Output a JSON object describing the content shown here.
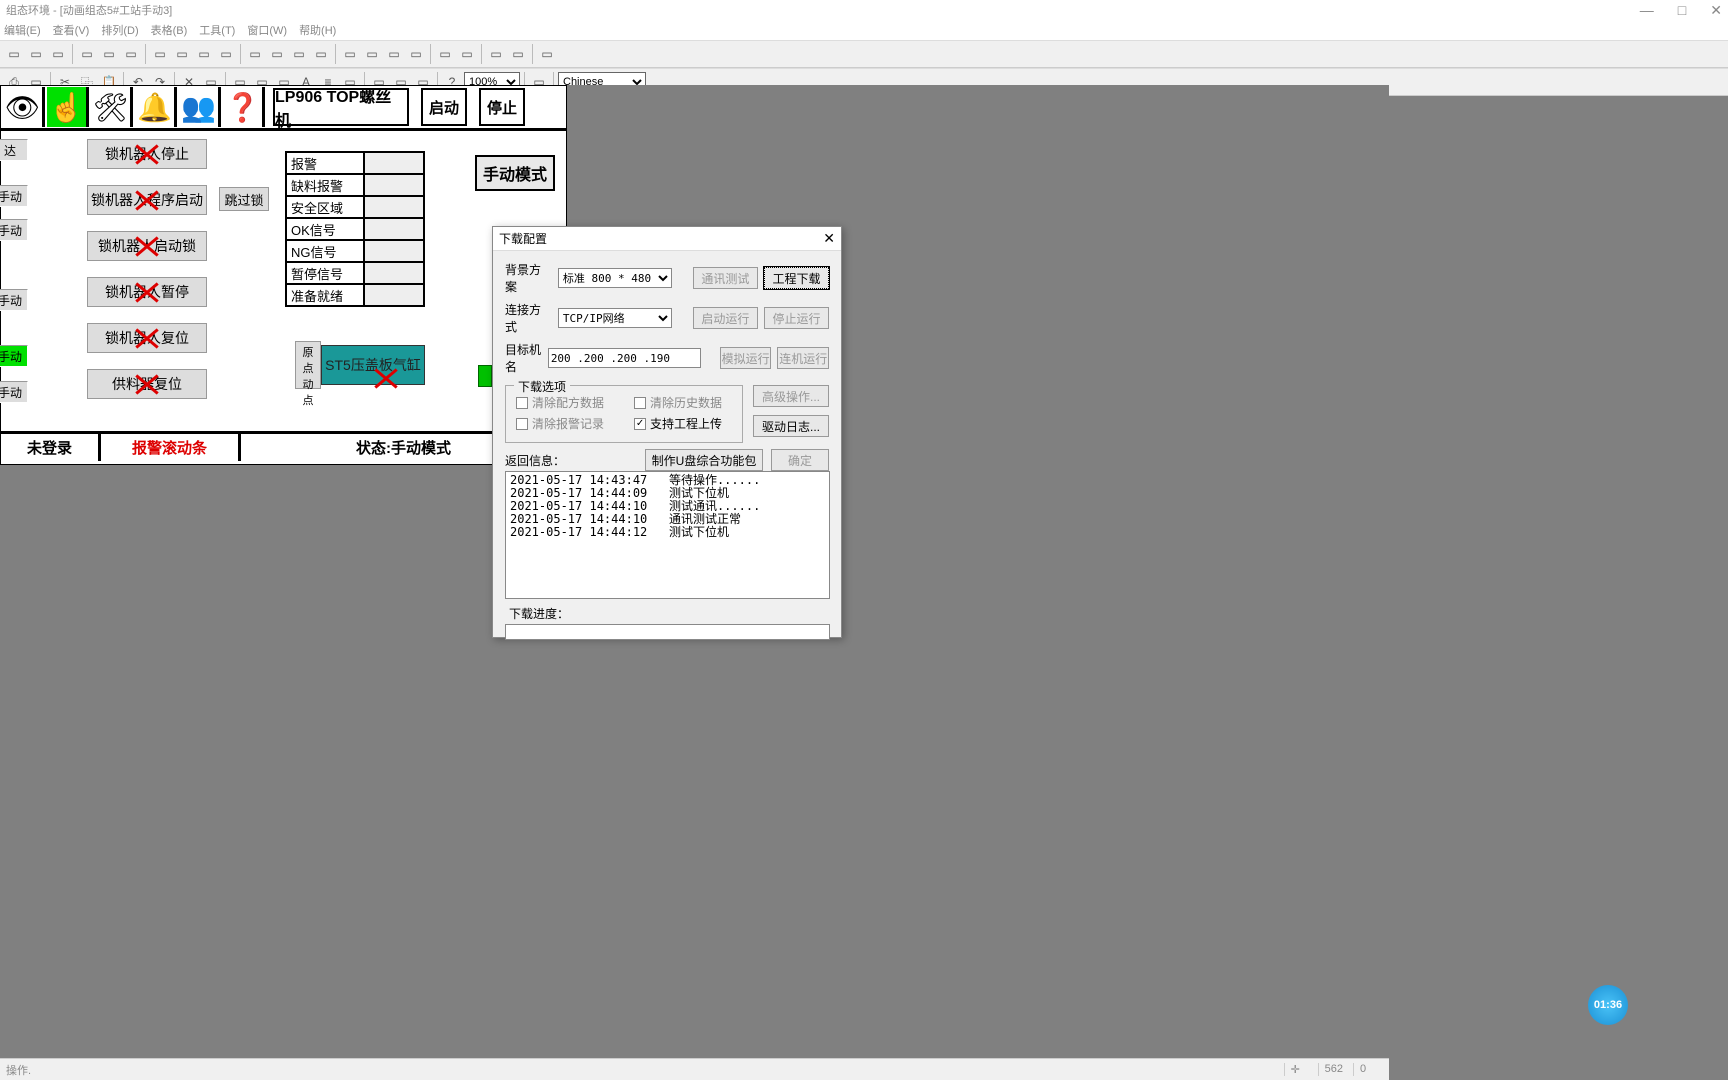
{
  "titlebar": "组态环境 - [动画组态5#工站手动3]",
  "menubar": [
    "编辑(E)",
    "查看(V)",
    "排列(D)",
    "表格(B)",
    "工具(T)",
    "窗口(W)",
    "帮助(H)"
  ],
  "toolbar2": {
    "zoom": "100%",
    "lang": "Chinese"
  },
  "hmi": {
    "title": "LP906 TOP螺丝机",
    "start": "启动",
    "stop": "停止",
    "side": [
      "达",
      "手动",
      "手动",
      "手动",
      "手动",
      "手动"
    ],
    "robot_buttons": [
      "锁机器人停止",
      "锁机器人程序启动",
      "锁机器人启动锁",
      "锁机器人暂停",
      "锁机器人复位",
      "供料器复位"
    ],
    "skip": "跳过锁",
    "mode": "手动模式",
    "signals": [
      "报警",
      "缺料报警",
      "安全区域",
      "OK信号",
      "NG信号",
      "暂停信号",
      "准备就绪"
    ],
    "origin": "原点动点",
    "teal": "ST5压盖板气缸",
    "status": {
      "user": "未登录",
      "alarm": "报警滚动条",
      "state": "状态:手动模式"
    }
  },
  "dialog": {
    "title": "下载配置",
    "bg_scheme_label": "背景方案",
    "bg_scheme": "标准 800 * 480",
    "conn_label": "连接方式",
    "conn": "TCP/IP网络",
    "target_label": "目标机名",
    "target": "200 .200 .200 .190",
    "btns": {
      "comm_test": "通讯测试",
      "download": "工程下载",
      "auto_run": "启动运行",
      "stop_run": "停止运行",
      "sim_run": "模拟运行",
      "conn_run": "连机运行",
      "adv": "高级操作...",
      "drv_log": "驱动日志...",
      "make_usb": "制作U盘综合功能包",
      "ok": "确定"
    },
    "options_legend": "下载选项",
    "chk_clear_recipe": "清除配方数据",
    "chk_clear_history": "清除历史数据",
    "chk_clear_alarm": "清除报警记录",
    "chk_support_upload": "支持工程上传",
    "return_label": "返回信息：",
    "log": "2021-05-17 14:43:47   等待操作......\n2021-05-17 14:44:09   测试下位机\n2021-05-17 14:44:10   测试通讯......\n2021-05-17 14:44:10   通讯测试正常\n2021-05-17 14:44:12   测试下位机",
    "progress_label": "下载进度："
  },
  "timer": "01:36",
  "statusbar": {
    "left": "操作.",
    "coord1": "562",
    "coord2": "0"
  }
}
